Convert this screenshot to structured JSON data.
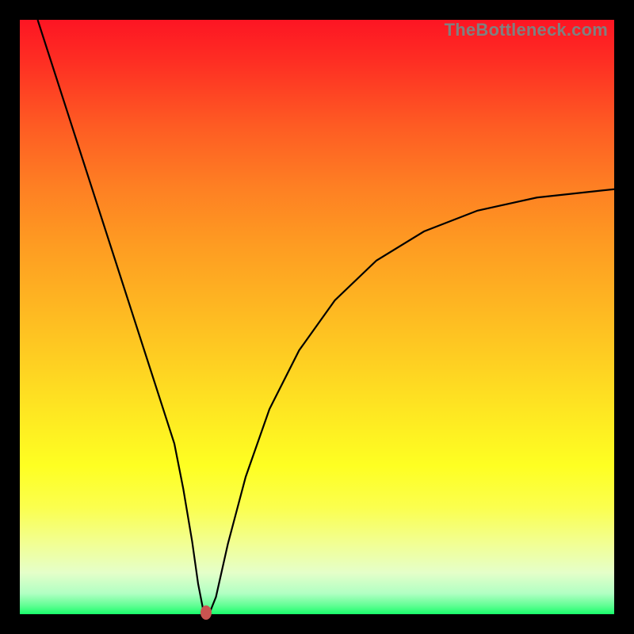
{
  "watermark": "TheBottleneck.com",
  "chart_data": {
    "type": "line",
    "title": "",
    "xlabel": "",
    "ylabel": "",
    "xlim": [
      0,
      100
    ],
    "ylim": [
      0,
      100
    ],
    "grid": false,
    "legend": false,
    "series": [
      {
        "name": "curve",
        "x": [
          3,
          6,
          10,
          14,
          18,
          22,
          26,
          27.5,
          29,
          30,
          30.8,
          31.3,
          32,
          33,
          35,
          38,
          42,
          47,
          53,
          60,
          68,
          77,
          87,
          100
        ],
        "y": [
          100,
          90.7,
          78.3,
          65.9,
          53.5,
          41.1,
          28.7,
          21.1,
          12.2,
          5.1,
          1.0,
          0.4,
          0.4,
          2.9,
          11.8,
          23.1,
          34.5,
          44.4,
          52.8,
          59.5,
          64.4,
          67.9,
          70.1,
          71.5
        ]
      }
    ],
    "annotations": [
      {
        "name": "marker",
        "x": 31.3,
        "y": 0.33,
        "color": "#c95450"
      }
    ],
    "background_gradient": {
      "top": "#fd1523",
      "mid": "#feff22",
      "bottom": "#19fd6a"
    }
  }
}
